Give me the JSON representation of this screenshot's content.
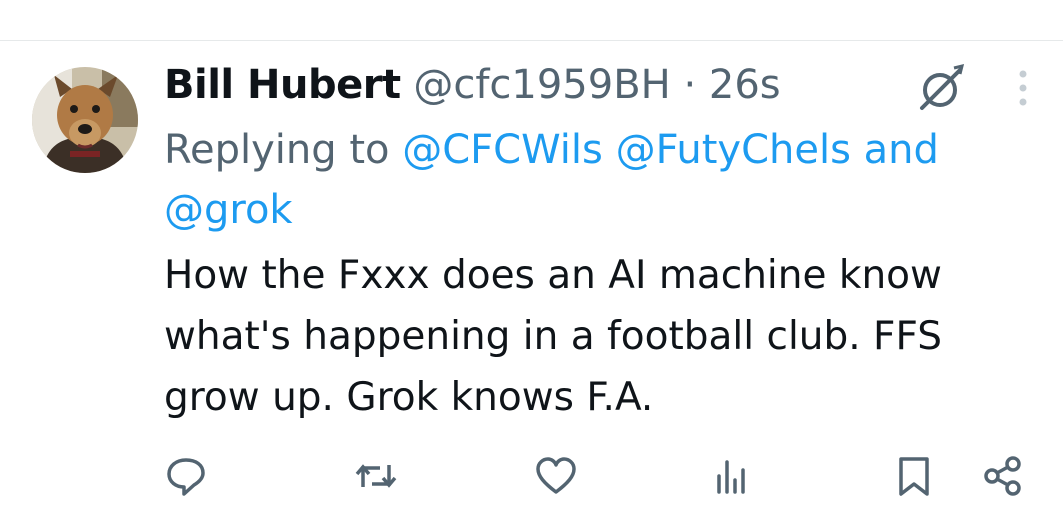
{
  "tweet": {
    "display_name": "Bill Hubert",
    "handle": "@cfc1959BH",
    "separator": "·",
    "timestamp": "26s",
    "replying_prefix": "Replying to",
    "reply_mentions": [
      "@CFCWils",
      "@FutyChels"
    ],
    "reply_conjunction": "and",
    "reply_last_mention": "@grok",
    "text": "How the Fxxx does an AI machine know what's happening in a football club. FFS grow up. Grok knows F.A."
  },
  "header_icons": {
    "grok": "grok-icon",
    "more": "more-options-icon"
  },
  "actions": [
    {
      "name": "reply",
      "icon": "reply-icon"
    },
    {
      "name": "retweet",
      "icon": "retweet-icon"
    },
    {
      "name": "like",
      "icon": "like-icon"
    },
    {
      "name": "views",
      "icon": "views-icon"
    },
    {
      "name": "bookmark",
      "icon": "bookmark-icon"
    },
    {
      "name": "share",
      "icon": "share-icon"
    }
  ],
  "colors": {
    "text": "#0f1419",
    "secondary": "#536471",
    "link": "#1d9bf0",
    "divider": "#e6e9ea"
  }
}
